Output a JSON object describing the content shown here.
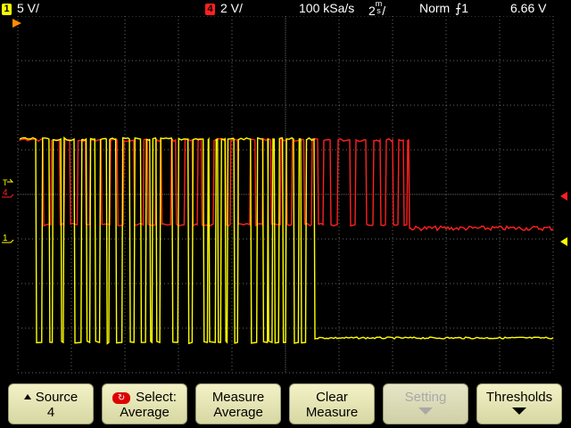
{
  "status": {
    "ch1_num": "1",
    "ch1_scale": "5 V/",
    "ch4_num": "4",
    "ch4_scale": "2 V/",
    "sample_rate": "100 kSa/s",
    "timebase": "2",
    "timebase_unit_top": "m",
    "timebase_unit_bottom": "s",
    "timebase_suffix": "/",
    "trigger_mode": "Norm",
    "trigger_source": "1",
    "trigger_level": "6.66  V"
  },
  "colors": {
    "ch1": "#ffff00",
    "ch4": "#ff2020",
    "grid": "#6a6a6a",
    "trigger_marker": "#ff8c00"
  },
  "markers": {
    "ch1": "1",
    "ch4": "4",
    "trigger": "T"
  },
  "softkeys": [
    {
      "line1": "Source",
      "line2": "4",
      "icon": "up-triangle"
    },
    {
      "line1": "Select:",
      "line2": "Average",
      "icon": "select-knob"
    },
    {
      "line1": "Measure",
      "line2": "Average"
    },
    {
      "line1": "Clear",
      "line2": "Measure"
    },
    {
      "line1": "Setting",
      "line2": "",
      "disabled": true,
      "icon": "down-triangle"
    },
    {
      "line1": "Thresholds",
      "line2": "",
      "icon": "down-triangle"
    }
  ]
}
